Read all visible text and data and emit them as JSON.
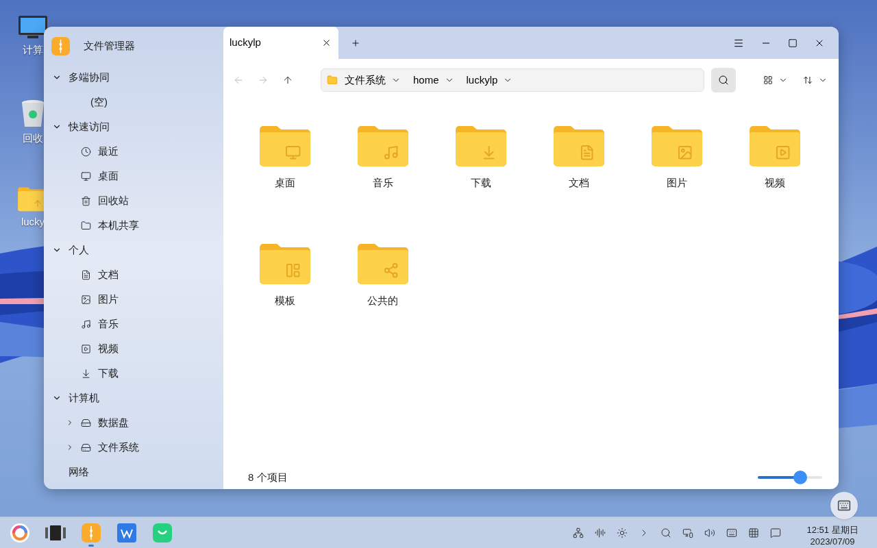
{
  "desktop": {
    "icons": [
      {
        "label": "计算",
        "kind": "computer"
      },
      {
        "label": "回收",
        "kind": "trash"
      },
      {
        "label": "lucky",
        "kind": "home"
      }
    ]
  },
  "window": {
    "app_title": "文件管理器",
    "sidebar": [
      {
        "label": "多端协同",
        "expanded": true,
        "items": [
          {
            "label": "(空)",
            "kind": "none"
          }
        ]
      },
      {
        "label": "快速访问",
        "expanded": true,
        "items": [
          {
            "label": "最近",
            "kind": "recent"
          },
          {
            "label": "桌面",
            "kind": "desktop"
          },
          {
            "label": "回收站",
            "kind": "trash"
          },
          {
            "label": "本机共享",
            "kind": "folder"
          }
        ]
      },
      {
        "label": "个人",
        "expanded": true,
        "items": [
          {
            "label": "文档",
            "kind": "document"
          },
          {
            "label": "图片",
            "kind": "picture"
          },
          {
            "label": "音乐",
            "kind": "music"
          },
          {
            "label": "视频",
            "kind": "video"
          },
          {
            "label": "下载",
            "kind": "download"
          }
        ]
      },
      {
        "label": "计算机",
        "expanded": true,
        "items": [
          {
            "label": "数据盘",
            "kind": "disk",
            "expanded": false
          },
          {
            "label": "文件系统",
            "kind": "disk",
            "expanded": false
          }
        ]
      },
      {
        "label": "网络"
      }
    ],
    "tabs": [
      {
        "label": "luckylp",
        "selected": true
      }
    ],
    "nav": [
      {
        "kind": "back",
        "disabled": true
      },
      {
        "kind": "forward",
        "disabled": true
      },
      {
        "kind": "up",
        "disabled": false
      }
    ],
    "breadcrumb": [
      "文件系统",
      "home",
      "luckylp"
    ],
    "files": [
      {
        "name": "桌面",
        "kind": "desktop"
      },
      {
        "name": "音乐",
        "kind": "music"
      },
      {
        "name": "下载",
        "kind": "download"
      },
      {
        "name": "文档",
        "kind": "document"
      },
      {
        "name": "图片",
        "kind": "picture"
      },
      {
        "name": "视频",
        "kind": "video"
      },
      {
        "name": "模板",
        "kind": "template"
      },
      {
        "name": "公共的",
        "kind": "share"
      }
    ],
    "status": "8 个项目",
    "zoom": {
      "level": 0.66
    }
  },
  "taskbar": {
    "apps": [
      {
        "kind": "launcher",
        "running": false
      },
      {
        "kind": "multitask",
        "running": false
      },
      {
        "kind": "files",
        "running": true
      },
      {
        "kind": "office",
        "running": false
      },
      {
        "kind": "store",
        "running": false
      }
    ],
    "tray": [
      {
        "kind": "network"
      },
      {
        "kind": "assistant"
      },
      {
        "kind": "brightness"
      },
      {
        "kind": "expand"
      },
      {
        "kind": "search"
      },
      {
        "kind": "display"
      },
      {
        "kind": "volume"
      },
      {
        "kind": "keyboard"
      },
      {
        "kind": "input"
      },
      {
        "kind": "notification"
      }
    ],
    "time": "12:51 星期日",
    "date": "2023/07/09"
  }
}
